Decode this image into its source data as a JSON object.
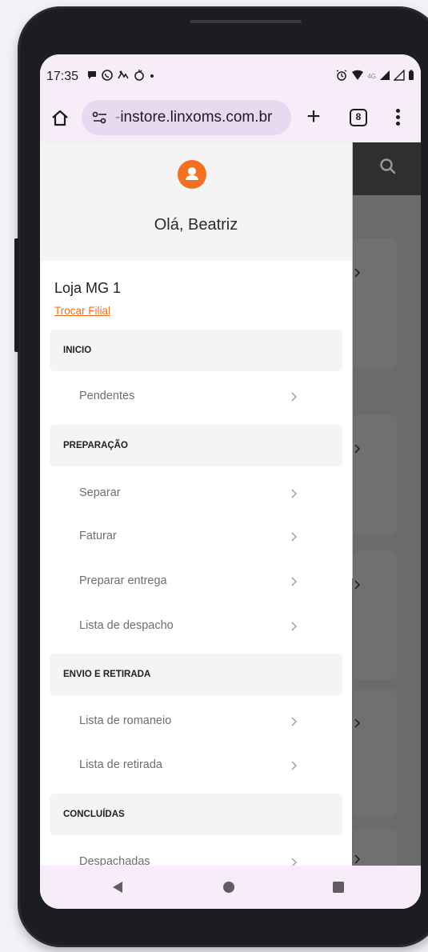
{
  "status_bar": {
    "time": "17:35",
    "network_label": "4G"
  },
  "browser": {
    "url_prefix": "-",
    "url": "instore.linxoms.com.br",
    "tab_count": "8",
    "new_tab_label": "+"
  },
  "drawer": {
    "greeting": "Olá, Beatriz",
    "store": "Loja MG 1",
    "switch_store": "Trocar Filial",
    "sections": [
      {
        "title": "INICIO",
        "items": [
          "Pendentes"
        ]
      },
      {
        "title": "PREPARAÇÃO",
        "items": [
          "Separar",
          "Faturar",
          "Preparar entrega",
          "Lista de despacho"
        ]
      },
      {
        "title": "ENVIO E RETIRADA",
        "items": [
          "Lista de romaneio",
          "Lista de retirada"
        ]
      },
      {
        "title": "CONCLUÍDAS",
        "items": [
          "Despachadas"
        ]
      }
    ]
  },
  "colors": {
    "accent": "#f37021",
    "app_header": "#2f2f2f",
    "system_bars": "#f6edf8"
  },
  "icons": {
    "home": "home-icon",
    "site_settings": "tune-icon",
    "search": "search-icon",
    "avatar": "user-icon",
    "chevron": "chevron-right-icon",
    "back": "back-triangle-icon",
    "home_nav": "home-circle-icon",
    "recents": "recents-square-icon"
  }
}
